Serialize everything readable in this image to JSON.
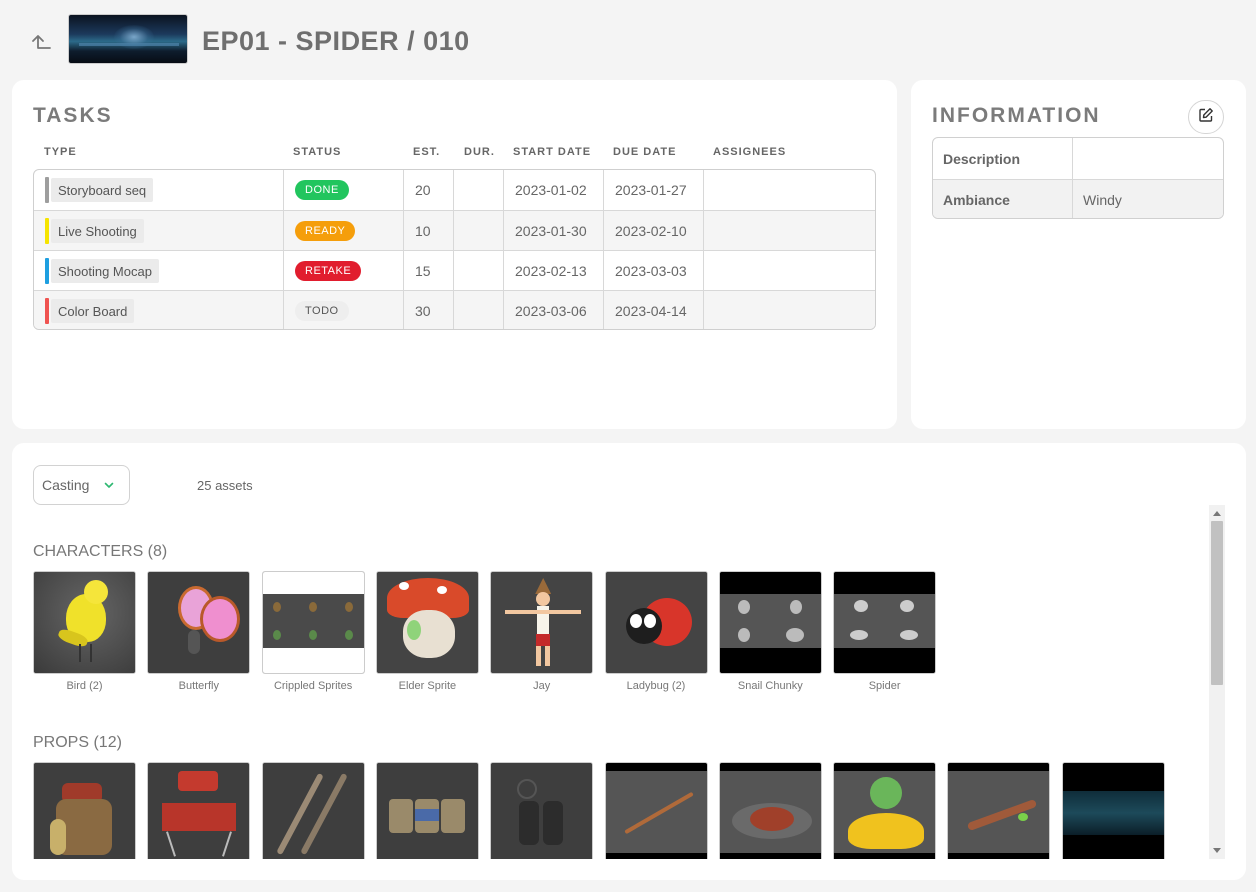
{
  "header": {
    "title": "EP01 - SPIDER / 010",
    "back_icon": "back-arrow-icon"
  },
  "tasks": {
    "section_title": "TASKS",
    "columns": [
      "TYPE",
      "STATUS",
      "EST.",
      "DUR.",
      "START DATE",
      "DUE DATE",
      "ASSIGNEES"
    ],
    "rows": [
      {
        "type": "Storyboard seq",
        "type_color": "#9e9e9e",
        "status": "DONE",
        "status_color": "#22c55e",
        "status_text_color": "#ffffff",
        "est": "20",
        "dur": "",
        "start": "2023-01-02",
        "due": "2023-01-27",
        "assignees": ""
      },
      {
        "type": "Live Shooting",
        "type_color": "#f5e400",
        "status": "READY",
        "status_color": "#f59e0b",
        "status_text_color": "#ffffff",
        "est": "10",
        "dur": "",
        "start": "2023-01-30",
        "due": "2023-02-10",
        "assignees": ""
      },
      {
        "type": "Shooting Mocap",
        "type_color": "#1e9fe0",
        "status": "RETAKE",
        "status_color": "#e11d2e",
        "status_text_color": "#ffffff",
        "est": "15",
        "dur": "",
        "start": "2023-02-13",
        "due": "2023-03-03",
        "assignees": ""
      },
      {
        "type": "Color Board",
        "type_color": "#ef5350",
        "status": "TODO",
        "status_color": "#eeeeee",
        "status_text_color": "#555555",
        "est": "30",
        "dur": "",
        "start": "2023-03-06",
        "due": "2023-04-14",
        "assignees": ""
      }
    ]
  },
  "information": {
    "section_title": "INFORMATION",
    "edit_icon": "edit-icon",
    "fields": [
      {
        "key": "Description",
        "value": ""
      },
      {
        "key": "Ambiance",
        "value": "Windy"
      }
    ]
  },
  "casting": {
    "mode": "Casting",
    "asset_count": "25 assets",
    "groups": [
      {
        "title": "CHARACTERS (8)",
        "assets": [
          {
            "name": "Bird (2)",
            "thumb": "bird"
          },
          {
            "name": "Butterfly",
            "thumb": "butterfly"
          },
          {
            "name": "Crippled Sprites",
            "thumb": "sprites"
          },
          {
            "name": "Elder Sprite",
            "thumb": "elder"
          },
          {
            "name": "Jay",
            "thumb": "jay"
          },
          {
            "name": "Ladybug (2)",
            "thumb": "ladybug"
          },
          {
            "name": "Snail Chunky",
            "thumb": "snail"
          },
          {
            "name": "Spider",
            "thumb": "spider"
          }
        ]
      },
      {
        "title": "PROPS (12)",
        "assets": [
          {
            "name": "",
            "thumb": "backpack"
          },
          {
            "name": "",
            "thumb": "grill"
          },
          {
            "name": "",
            "thumb": "tongs"
          },
          {
            "name": "",
            "thumb": "cans"
          },
          {
            "name": "",
            "thumb": "binoculars"
          },
          {
            "name": "",
            "thumb": "stick"
          },
          {
            "name": "",
            "thumb": "campfire"
          },
          {
            "name": "",
            "thumb": "flower"
          },
          {
            "name": "",
            "thumb": "branch"
          },
          {
            "name": "",
            "thumb": "forest"
          }
        ]
      }
    ]
  }
}
